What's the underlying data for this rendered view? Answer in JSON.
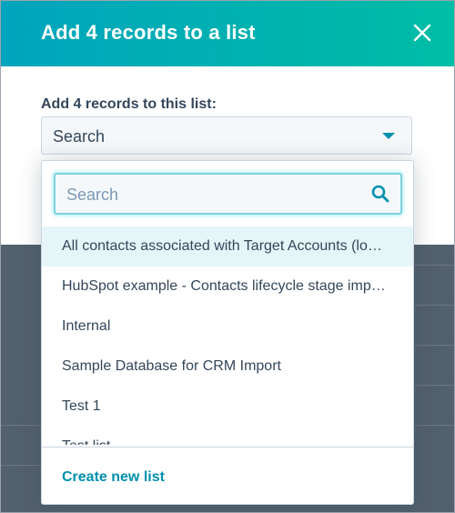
{
  "modal": {
    "title": "Add 4 records to a list",
    "close_icon": "close-icon",
    "header_color": "#00bda5"
  },
  "form": {
    "label": "Add 4 records to this list:",
    "select_value": "Search",
    "caret_icon": "caret-down-icon"
  },
  "dropdown": {
    "search_placeholder": "Search",
    "search_icon": "search-icon",
    "options": [
      {
        "label": "All contacts associated with Target Accounts (lo…",
        "highlighted": true
      },
      {
        "label": "HubSpot example - Contacts lifecycle stage imp…",
        "highlighted": false
      },
      {
        "label": "Internal",
        "highlighted": false
      },
      {
        "label": "Sample Database for CRM Import",
        "highlighted": false
      },
      {
        "label": "Test 1",
        "highlighted": false
      },
      {
        "label": "Test list",
        "highlighted": false
      }
    ],
    "footer_link": "Create new list"
  },
  "colors": {
    "accent": "#0091ae",
    "text": "#33475b",
    "overlay": "#53606e",
    "highlight": "#e5f5f8"
  }
}
